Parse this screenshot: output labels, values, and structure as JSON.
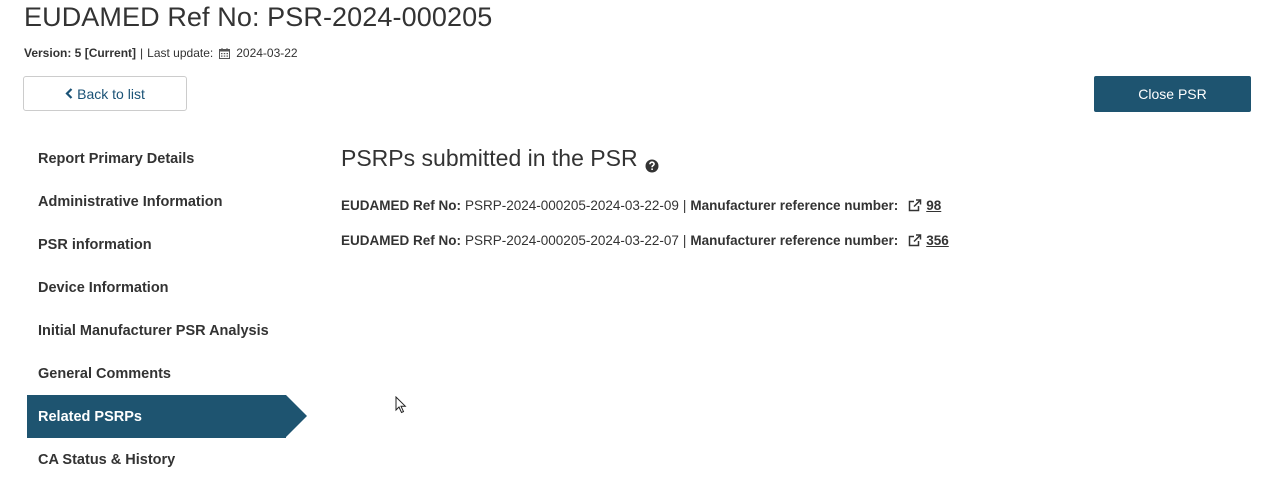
{
  "header": {
    "title": "EUDAMED Ref No: PSR-2024-000205",
    "version_label": "Version: 5 [Current]",
    "separator": "|",
    "last_update_label": "Last update:",
    "last_update_date": "2024-03-22",
    "calendar_icon": "calendar-icon"
  },
  "toolbar": {
    "back_label": "Back to list",
    "back_icon": "chevron-left-icon",
    "close_label": "Close PSR"
  },
  "sidebar": {
    "items": [
      {
        "label": "Report Primary Details",
        "active": false
      },
      {
        "label": "Administrative Information",
        "active": false
      },
      {
        "label": "PSR information",
        "active": false
      },
      {
        "label": "Device Information",
        "active": false
      },
      {
        "label": "Initial Manufacturer PSR Analysis",
        "active": false
      },
      {
        "label": "General Comments",
        "active": false
      },
      {
        "label": "Related PSRPs",
        "active": true
      },
      {
        "label": "CA Status & History",
        "active": false
      }
    ]
  },
  "main": {
    "section_title": "PSRPs submitted in the PSR",
    "help_icon": "question-circle-icon",
    "refs": [
      {
        "ref_label": "EUDAMED Ref No:",
        "ref_value": "PSRP-2024-000205-2024-03-22-09",
        "separator": "|",
        "mfr_label": "Manufacturer reference number:",
        "mfr_value": "98"
      },
      {
        "ref_label": "EUDAMED Ref No:",
        "ref_value": "PSRP-2024-000205-2024-03-22-07",
        "separator": "|",
        "mfr_label": "Manufacturer reference number:",
        "mfr_value": "356"
      }
    ],
    "link_icon": "external-link-icon"
  },
  "colors": {
    "primary": "#1e5470",
    "text": "#333333",
    "link": "#1a5276"
  }
}
